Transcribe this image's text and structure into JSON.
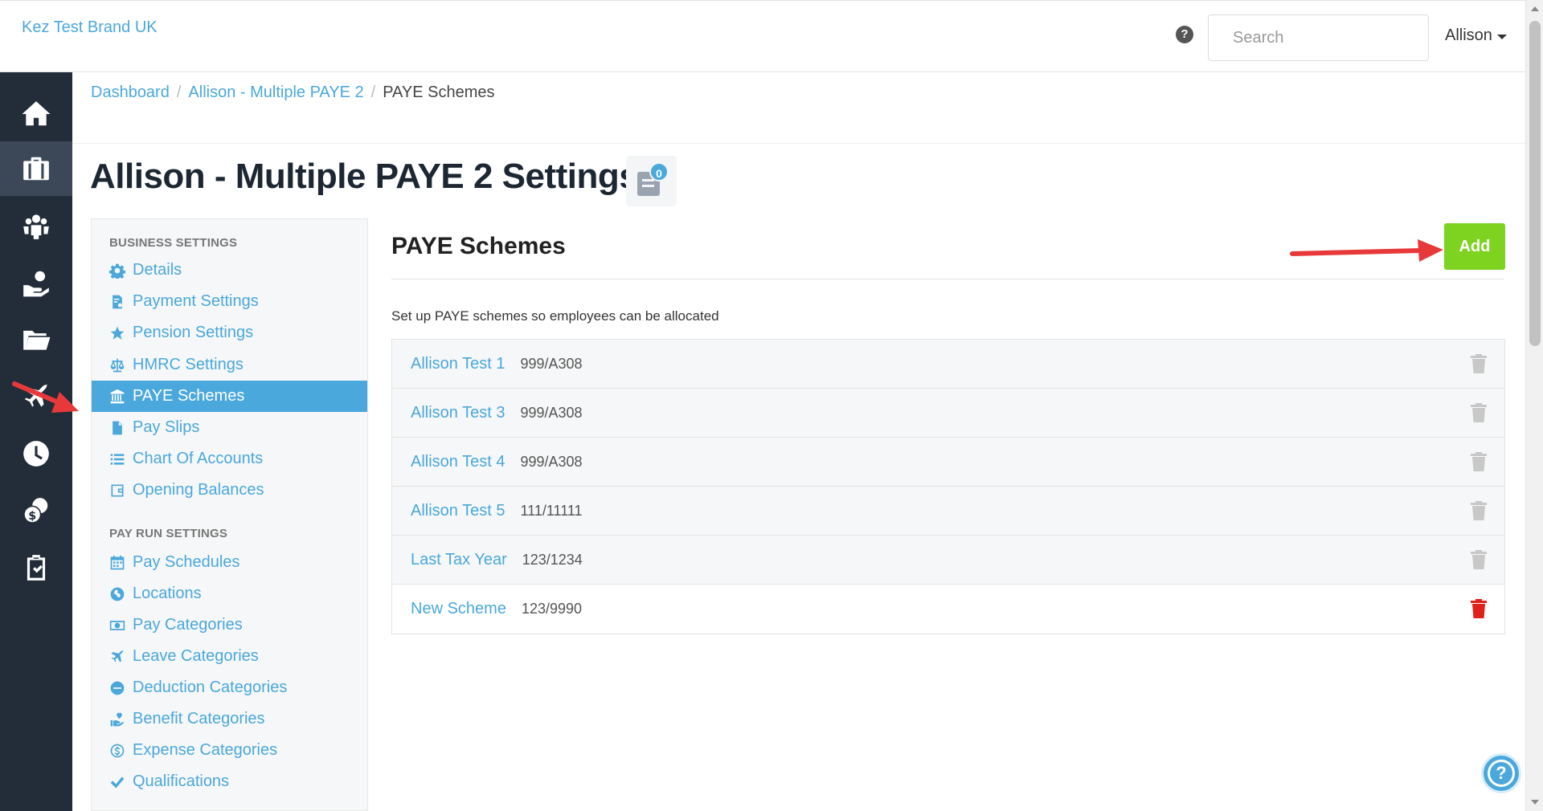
{
  "header": {
    "brand": "Kez Test Brand UK",
    "search_placeholder": "Search",
    "user_name": "Allison"
  },
  "breadcrumb": {
    "items": [
      "Dashboard",
      "Allison - Multiple PAYE 2"
    ],
    "current": "PAYE Schemes"
  },
  "page": {
    "title": "Allison - Multiple PAYE 2 Settings",
    "notes_count": "0"
  },
  "rail": {
    "icons": [
      "home-icon",
      "briefcase-icon",
      "people-icon",
      "hand-coin-icon",
      "folder-icon",
      "plane-icon",
      "clock-icon",
      "coins-icon",
      "clipboard-check-icon"
    ],
    "active_index": 1
  },
  "side_menu": {
    "business_heading": "BUSINESS SETTINGS",
    "business_items": [
      {
        "label": "Details",
        "icon": "gear-icon"
      },
      {
        "label": "Payment Settings",
        "icon": "payment-doc-icon"
      },
      {
        "label": "Pension Settings",
        "icon": "star-icon"
      },
      {
        "label": "HMRC Settings",
        "icon": "scale-icon"
      },
      {
        "label": "PAYE Schemes",
        "icon": "bank-icon"
      },
      {
        "label": "Pay Slips",
        "icon": "file-icon"
      },
      {
        "label": "Chart Of Accounts",
        "icon": "list-icon"
      },
      {
        "label": "Opening Balances",
        "icon": "wallet-icon"
      }
    ],
    "payrun_heading": "PAY RUN SETTINGS",
    "payrun_items": [
      {
        "label": "Pay Schedules",
        "icon": "calendar-icon"
      },
      {
        "label": "Locations",
        "icon": "globe-icon"
      },
      {
        "label": "Pay Categories",
        "icon": "money-icon"
      },
      {
        "label": "Leave Categories",
        "icon": "plane-icon"
      },
      {
        "label": "Deduction Categories",
        "icon": "minus-circle-icon"
      },
      {
        "label": "Benefit Categories",
        "icon": "heart-hand-icon"
      },
      {
        "label": "Expense Categories",
        "icon": "dollar-circle-icon"
      },
      {
        "label": "Qualifications",
        "icon": "check-icon"
      }
    ],
    "active_label": "PAYE Schemes"
  },
  "main": {
    "title": "PAYE Schemes",
    "add_label": "Add",
    "description": "Set up PAYE schemes so employees can be allocated",
    "schemes": [
      {
        "name": "Allison Test 1",
        "ref": "999/A308",
        "delete_enabled": false
      },
      {
        "name": "Allison Test 3",
        "ref": "999/A308",
        "delete_enabled": false
      },
      {
        "name": "Allison Test 4",
        "ref": "999/A308",
        "delete_enabled": false
      },
      {
        "name": "Allison Test 5",
        "ref": "111/11111",
        "delete_enabled": false
      },
      {
        "name": "Last Tax Year",
        "ref": "123/1234",
        "delete_enabled": false
      },
      {
        "name": "New Scheme",
        "ref": "123/9990",
        "delete_enabled": true
      }
    ]
  },
  "colors": {
    "accent": "#4aa8dc",
    "add_green": "#7ed321",
    "rail_bg": "#232d3a",
    "annotation_red": "#e8393a",
    "danger": "#e0201a"
  }
}
